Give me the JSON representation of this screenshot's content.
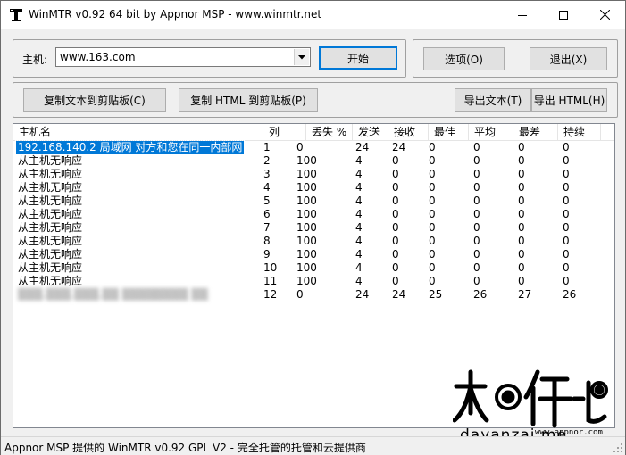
{
  "window": {
    "title": "WinMTR v0.92 64 bit by Appnor MSP - www.winmtr.net",
    "icon": "mtr-app-icon",
    "controls": [
      "minimize-icon",
      "maximize-icon",
      "close-icon"
    ]
  },
  "host": {
    "label": "主机:",
    "value": "www.163.com",
    "start_button": "开始"
  },
  "top_buttons": {
    "options": "选项(O)",
    "exit": "退出(X)"
  },
  "clipboard": {
    "copy_text": "复制文本到剪贴板(C)",
    "copy_html": "复制 HTML 到剪贴板(P)",
    "export_text": "导出文本(T)",
    "export_html": "导出 HTML(H)"
  },
  "table": {
    "columns": [
      "主机名",
      "列",
      "丢失 %",
      "发送",
      "接收",
      "最佳",
      "平均",
      "最差",
      "持续"
    ],
    "rows": [
      {
        "host": "192.168.140.2 局域网 对方和您在同一内部网",
        "nr": "1",
        "loss": "0",
        "sent": "24",
        "recv": "24",
        "best": "0",
        "avg": "0",
        "worst": "0",
        "last": "0",
        "selected": true
      },
      {
        "host": "从主机无响应",
        "nr": "2",
        "loss": "100",
        "sent": "4",
        "recv": "0",
        "best": "0",
        "avg": "0",
        "worst": "0",
        "last": "0"
      },
      {
        "host": "从主机无响应",
        "nr": "3",
        "loss": "100",
        "sent": "4",
        "recv": "0",
        "best": "0",
        "avg": "0",
        "worst": "0",
        "last": "0"
      },
      {
        "host": "从主机无响应",
        "nr": "4",
        "loss": "100",
        "sent": "4",
        "recv": "0",
        "best": "0",
        "avg": "0",
        "worst": "0",
        "last": "0"
      },
      {
        "host": "从主机无响应",
        "nr": "5",
        "loss": "100",
        "sent": "4",
        "recv": "0",
        "best": "0",
        "avg": "0",
        "worst": "0",
        "last": "0"
      },
      {
        "host": "从主机无响应",
        "nr": "6",
        "loss": "100",
        "sent": "4",
        "recv": "0",
        "best": "0",
        "avg": "0",
        "worst": "0",
        "last": "0"
      },
      {
        "host": "从主机无响应",
        "nr": "7",
        "loss": "100",
        "sent": "4",
        "recv": "0",
        "best": "0",
        "avg": "0",
        "worst": "0",
        "last": "0"
      },
      {
        "host": "从主机无响应",
        "nr": "8",
        "loss": "100",
        "sent": "4",
        "recv": "0",
        "best": "0",
        "avg": "0",
        "worst": "0",
        "last": "0"
      },
      {
        "host": "从主机无响应",
        "nr": "9",
        "loss": "100",
        "sent": "4",
        "recv": "0",
        "best": "0",
        "avg": "0",
        "worst": "0",
        "last": "0"
      },
      {
        "host": "从主机无响应",
        "nr": "10",
        "loss": "100",
        "sent": "4",
        "recv": "0",
        "best": "0",
        "avg": "0",
        "worst": "0",
        "last": "0"
      },
      {
        "host": "从主机无响应",
        "nr": "11",
        "loss": "100",
        "sent": "4",
        "recv": "0",
        "best": "0",
        "avg": "0",
        "worst": "0",
        "last": "0"
      },
      {
        "host": "▒▒▒.▒▒▒.▒▒▒.▒▒ ▒▒▒▒▒▒▒▒ ▒▒",
        "nr": "12",
        "loss": "0",
        "sent": "24",
        "recv": "24",
        "best": "25",
        "avg": "26",
        "worst": "27",
        "last": "26",
        "blurred": true
      }
    ]
  },
  "status": {
    "text": "Appnor MSP 提供的 WinMTR v0.92 GPL V2 - 完全托管的托管和云提供商"
  },
  "watermark": {
    "logo_text": "大眼仔~旭",
    "domain": "dayanzai.me",
    "url": "www.appnor.com"
  }
}
